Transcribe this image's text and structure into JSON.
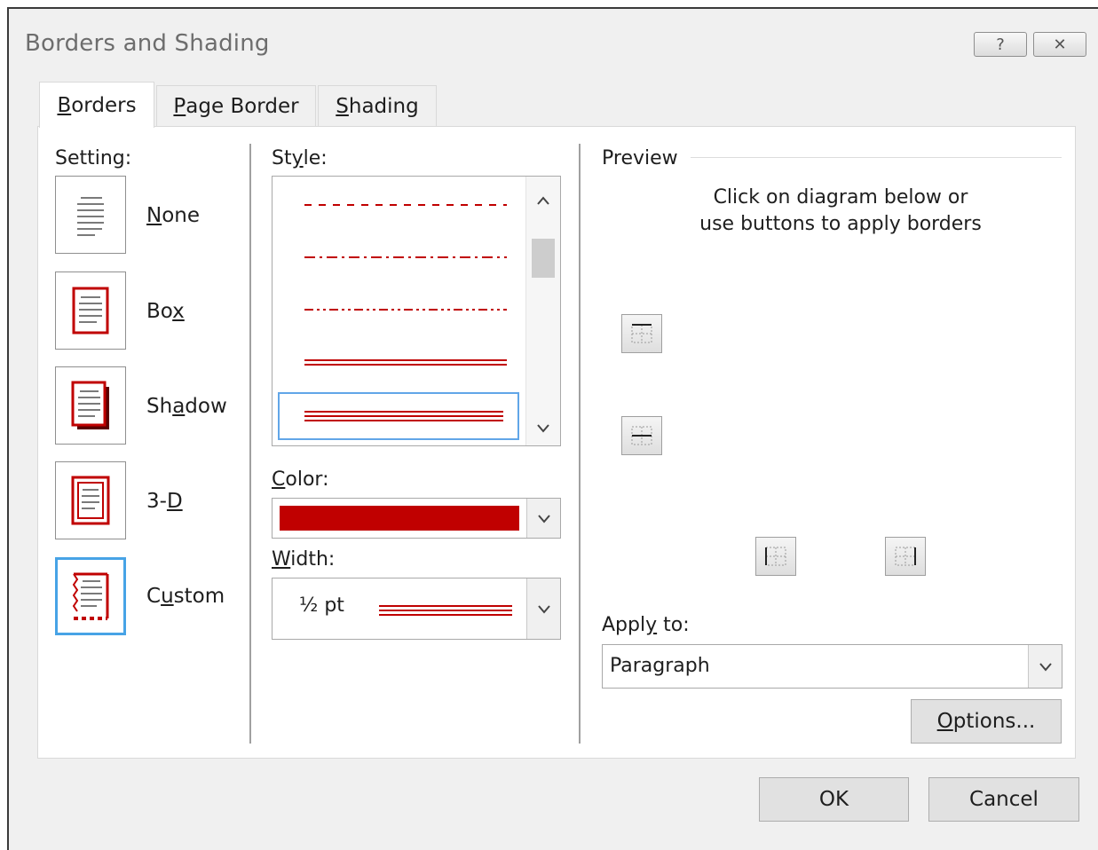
{
  "window": {
    "title": "Borders and Shading",
    "help_glyph": "?",
    "close_glyph": "✕"
  },
  "tabs": [
    {
      "label": "Borders",
      "accel": "B",
      "rest": "orders",
      "active": true
    },
    {
      "label": "Page Border",
      "accel": "P",
      "rest": "age Border",
      "active": false
    },
    {
      "label": "Shading",
      "accel": "S",
      "rest": "hading",
      "active": false
    }
  ],
  "setting": {
    "label_pre": "Setting:",
    "items": [
      {
        "label": "None",
        "pre": "",
        "accel": "N",
        "post": "one",
        "icon": "setting-none-icon"
      },
      {
        "label": "Box",
        "pre": "Bo",
        "accel": "x",
        "post": "",
        "icon": "setting-box-icon"
      },
      {
        "label": "Shadow",
        "pre": "Sh",
        "accel": "a",
        "post": "dow",
        "icon": "setting-shadow-icon"
      },
      {
        "label": "3-D",
        "pre": "3-",
        "accel": "D",
        "post": "",
        "icon": "setting-3d-icon"
      },
      {
        "label": "Custom",
        "pre": "C",
        "accel": "u",
        "post": "stom",
        "icon": "setting-custom-icon",
        "selected": true
      }
    ]
  },
  "style": {
    "label_pre": "St",
    "label_accel": "y",
    "label_post": "le:",
    "items": [
      "dash",
      "dash-dot",
      "dash-dot-dot",
      "double",
      "triple"
    ],
    "selected_index": 4,
    "scroll_up": "^",
    "scroll_down": "v"
  },
  "color": {
    "label_accel": "C",
    "label_post": "olor:",
    "value": "#c00000"
  },
  "width": {
    "label_accel": "W",
    "label_post": "idth:",
    "value": "½ pt"
  },
  "preview": {
    "title": "Preview",
    "instruction_line1": "Click on diagram below or",
    "instruction_line2": "use buttons to apply borders",
    "buttons": [
      "top-border-icon",
      "inside-horizontal-border-icon",
      "left-border-icon",
      "right-border-icon"
    ]
  },
  "apply_to": {
    "label_pre": "Appl",
    "label_accel": "y",
    "label_post": " to:",
    "value": "Paragraph"
  },
  "options_button": {
    "accel": "O",
    "rest": "ptions..."
  },
  "ok_button": "OK",
  "cancel_button": "Cancel",
  "colors": {
    "accent_red": "#c00000",
    "selection_blue": "#47a3e6"
  }
}
